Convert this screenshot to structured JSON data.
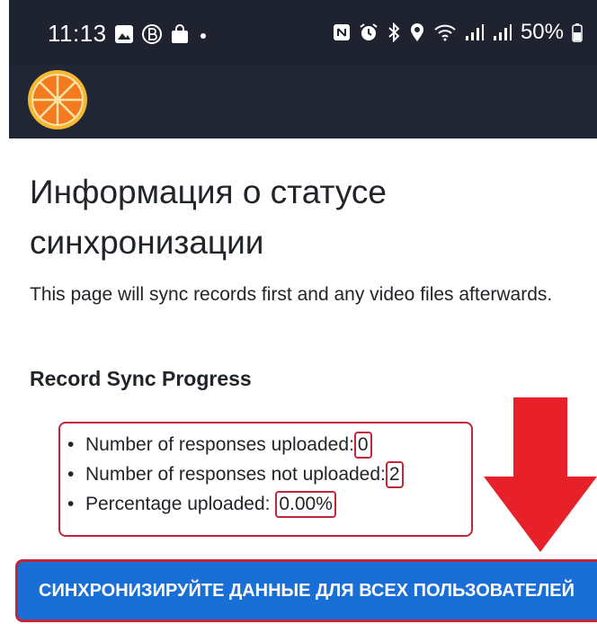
{
  "status_bar": {
    "time": "11:13",
    "battery": "50%",
    "icons_left": [
      "gallery-icon",
      "b-circle-icon",
      "shopping-bag-icon",
      "dot-icon"
    ],
    "icons_right": [
      "nfc-icon",
      "alarm-icon",
      "bluetooth-icon",
      "location-icon",
      "wifi-icon",
      "signal-icon",
      "signal-icon",
      "battery-icon"
    ]
  },
  "header": {
    "logo": "orange-slice-logo"
  },
  "page": {
    "title": "Информация о статусе синхронизации",
    "intro": "This page will sync records first and any video files afterwards.",
    "section_heading": "Record Sync Progress"
  },
  "stats": {
    "uploaded_label": "Number of responses uploaded:",
    "uploaded_value": "0",
    "not_uploaded_label": "Number of responses not uploaded:",
    "not_uploaded_value": "2",
    "percentage_label": "Percentage uploaded:",
    "percentage_value": "0.00%"
  },
  "actions": {
    "sync_all_label": "СИНХРОНИЗИРУЙТЕ ДАННЫЕ ДЛЯ ВСЕХ ПОЛЬЗОВАТЕЛЕЙ"
  },
  "colors": {
    "status_bar_bg": "#1f2330",
    "header_bg": "#202634",
    "annotation_red": "#c0283a",
    "arrow_red": "#e8202a",
    "button_blue": "#1a6fd6"
  }
}
